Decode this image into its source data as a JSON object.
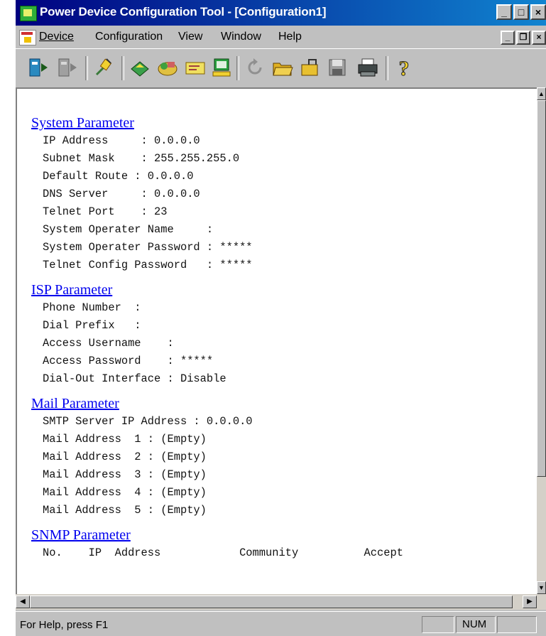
{
  "window": {
    "title": "Power Device Configuration Tool - [Configuration1]",
    "controls": {
      "minimize": "_",
      "maximize": "□",
      "close": "×"
    },
    "mdi_controls": {
      "minimize": "_",
      "restore": "❐",
      "close": "×"
    }
  },
  "menu": [
    {
      "label": "Device"
    },
    {
      "label": "Configuration"
    },
    {
      "label": "View"
    },
    {
      "label": "Window"
    },
    {
      "label": "Help"
    }
  ],
  "toolbar": {
    "icons": [
      "connect-icon",
      "disconnect-icon",
      "plug-icon",
      "upload-icon",
      "network-icon",
      "email-icon",
      "computer-icon",
      "refresh-icon",
      "open-folder-icon",
      "open-icon",
      "save-icon",
      "print-icon",
      "help-icon"
    ]
  },
  "sections": [
    {
      "heading": "System Parameter",
      "rows": [
        "IP Address     : 0.0.0.0",
        "Subnet Mask    : 255.255.255.0",
        "Default Route : 0.0.0.0",
        "DNS Server     : 0.0.0.0",
        "Telnet Port    : 23",
        "System Operater Name     :",
        "System Operater Password : *****",
        "Telnet Config Password   : *****"
      ]
    },
    {
      "heading": "ISP Parameter",
      "rows": [
        "Phone Number  :",
        "Dial Prefix   :",
        "Access Username    :",
        "Access Password    : *****",
        "Dial-Out Interface : Disable"
      ]
    },
    {
      "heading": "Mail Parameter",
      "rows": [
        "SMTP Server IP Address : 0.0.0.0",
        "Mail Address  1 : (Empty)",
        "Mail Address  2 : (Empty)",
        "Mail Address  3 : (Empty)",
        "Mail Address  4 : (Empty)",
        "Mail Address  5 : (Empty)"
      ]
    },
    {
      "heading": "SNMP Parameter",
      "rows": [
        "No.    IP  Address            Community          Accept"
      ]
    }
  ],
  "status": {
    "message": "For Help, press F1",
    "indicator": "NUM"
  }
}
